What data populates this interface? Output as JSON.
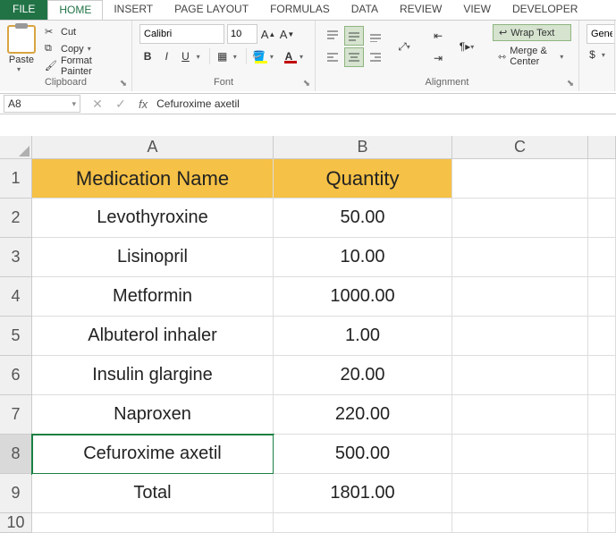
{
  "tabs": {
    "file": "FILE",
    "home": "HOME",
    "insert": "INSERT",
    "page_layout": "PAGE LAYOUT",
    "formulas": "FORMULAS",
    "data": "DATA",
    "review": "REVIEW",
    "view": "VIEW",
    "developer": "DEVELOPER"
  },
  "clipboard": {
    "paste": "Paste",
    "cut": "Cut",
    "copy": "Copy",
    "format_painter": "Format Painter",
    "label": "Clipboard"
  },
  "font": {
    "name": "Calibri",
    "size": "10",
    "label": "Font"
  },
  "alignment": {
    "wrap": "Wrap Text",
    "merge": "Merge & Center",
    "label": "Alignment"
  },
  "number": {
    "format": "Gene",
    "currency": "$"
  },
  "namebox": "A8",
  "formula_content": "Cefuroxime axetil",
  "columns": [
    "A",
    "B",
    "C"
  ],
  "headers": {
    "A": "Medication Name",
    "B": "Quantity"
  },
  "rows": [
    {
      "n": "2",
      "A": "Levothyroxine",
      "B": "50.00"
    },
    {
      "n": "3",
      "A": "Lisinopril",
      "B": "10.00"
    },
    {
      "n": "4",
      "A": "Metformin",
      "B": "1000.00"
    },
    {
      "n": "5",
      "A": "Albuterol inhaler",
      "B": "1.00"
    },
    {
      "n": "6",
      "A": "Insulin glargine",
      "B": "20.00"
    },
    {
      "n": "7",
      "A": "Naproxen",
      "B": "220.00"
    },
    {
      "n": "8",
      "A": "Cefuroxime axetil",
      "B": "500.00"
    },
    {
      "n": "9",
      "A": "Total",
      "B": "1801.00"
    }
  ],
  "row10": "10"
}
